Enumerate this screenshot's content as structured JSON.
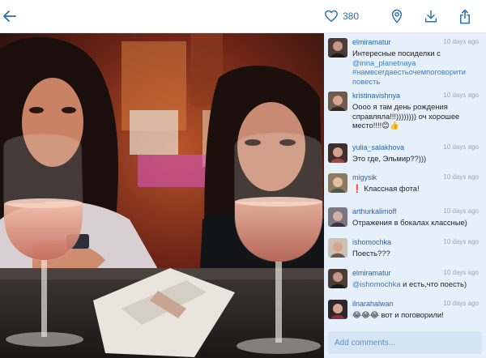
{
  "toolbar": {
    "likes": "380",
    "icons": [
      "back-arrow-icon",
      "heart-icon",
      "location-pin-icon",
      "download-icon",
      "share-icon"
    ],
    "accent": "#2b6fb0"
  },
  "comments": [
    {
      "user": "elmiramatur",
      "time": "10 days ago",
      "text": "Интересные посиделки с ",
      "mention": "@inna_planetnaya",
      "hashtag": "#намвсегдаестьочемпоговоритьиповесть",
      "line1": "Интересные посиделки с",
      "line2": "@inna_planetnaya",
      "line3": "#намвсегдаестьочемпоговорити",
      "line4": "повесть"
    },
    {
      "user": "kristinavishnya",
      "time": "10 days ago",
      "line1": "Оооо я там день рождения",
      "line2": "справляла!!!)))))))) оч хорошее",
      "line3": "место!!!!😊👍"
    },
    {
      "user": "yulia_salakhova",
      "time": "10 days ago",
      "line1": "Это где, Эльмир??)))"
    },
    {
      "user": "migysik",
      "time": "10 days ago",
      "line1": "❗ Классная фота!"
    },
    {
      "user": "arthurkalimoff",
      "time": "10 days ago",
      "line1": "Отражения в бокалах классные)"
    },
    {
      "user": "ishomochka",
      "time": "10 days ago",
      "line1": "Поесть???"
    },
    {
      "user": "elmiramatur",
      "time": "10 days ago",
      "mention": "@ishomochka",
      "rest": " и есть,что поесть)"
    },
    {
      "user": "ilnarahalwan",
      "time": "10 days ago",
      "line1": "😂😂😂 вот и поговорили!"
    }
  ],
  "input": {
    "placeholder": "Add comments..."
  },
  "colors": {
    "comment_bg": "#e6f0fa",
    "username": "#2a63a8",
    "link": "#3a7cc4",
    "timestamp": "#9aa6b2"
  }
}
